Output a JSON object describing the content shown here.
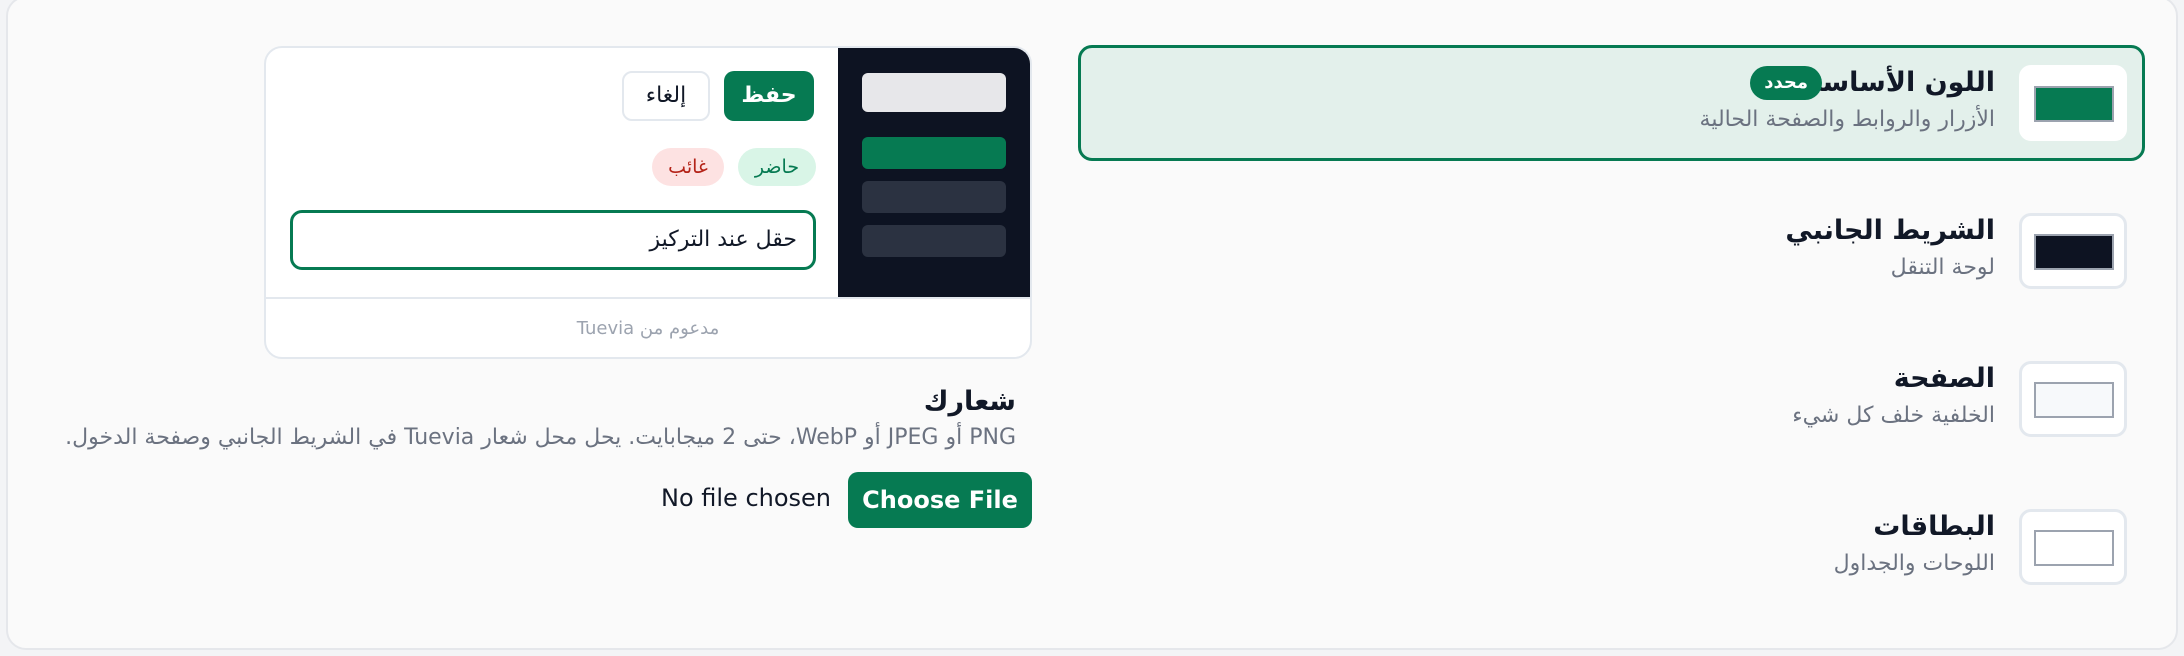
{
  "colors": {
    "brand": "#067a52",
    "sidebar": "#0d1322",
    "page": "#f7f9fb",
    "card": "#ffffff",
    "selected_bg": "#e3f0eb"
  },
  "color_options": [
    {
      "title": "اللون الأساسي",
      "description": "الأزرار والروابط والصفحة الحالية",
      "badge": "محدد",
      "swatch": "#067a52",
      "selected": true
    },
    {
      "title": "الشريط الجانبي",
      "description": "لوحة التنقل",
      "swatch": "#0d1322",
      "selected": false
    },
    {
      "title": "الصفحة",
      "description": "الخلفية خلف كل شيء",
      "swatch": "#f7f9fb",
      "selected": false
    },
    {
      "title": "البطاقات",
      "description": "اللوحات والجداول",
      "swatch": "#ffffff",
      "selected": false
    }
  ],
  "preview": {
    "save_label": "حفظ",
    "cancel_label": "إلغاء",
    "chip_present": "حاضر",
    "chip_absent": "غائب",
    "focus_input_value": "حقل عند التركيز",
    "footer": "مدعوم من Tuevia"
  },
  "logo": {
    "title": "شعارك",
    "description": "PNG أو JPEG أو WebP، حتى 2 ميجابايت. يحل محل شعار Tuevia في الشريط الجانبي وصفحة الدخول.",
    "choose_file_label": "Choose File",
    "no_file_label": "No file chosen"
  }
}
